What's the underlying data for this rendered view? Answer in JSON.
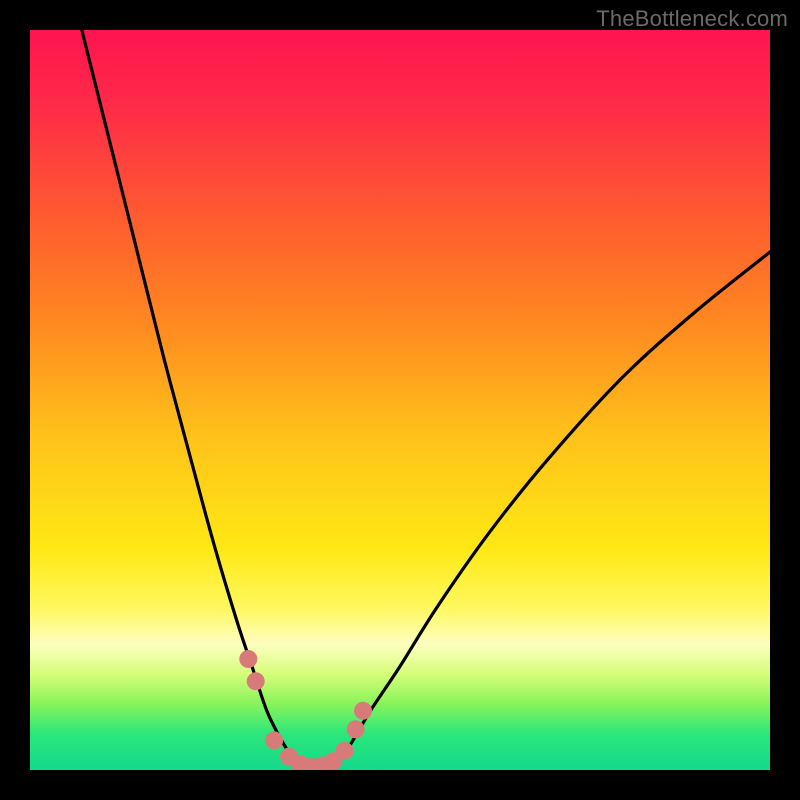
{
  "watermark": "TheBottleneck.com",
  "gradient_stops": [
    {
      "offset": 0.0,
      "color": "#ff1450"
    },
    {
      "offset": 0.1,
      "color": "#ff2a48"
    },
    {
      "offset": 0.25,
      "color": "#ff5a30"
    },
    {
      "offset": 0.4,
      "color": "#ff8a20"
    },
    {
      "offset": 0.55,
      "color": "#ffc21a"
    },
    {
      "offset": 0.7,
      "color": "#ffe814"
    },
    {
      "offset": 0.78,
      "color": "#fff85e"
    },
    {
      "offset": 0.83,
      "color": "#fdfec0"
    },
    {
      "offset": 0.87,
      "color": "#d6fd7a"
    },
    {
      "offset": 0.91,
      "color": "#8af45a"
    },
    {
      "offset": 0.95,
      "color": "#2de77a"
    },
    {
      "offset": 1.0,
      "color": "#13d98c"
    }
  ],
  "chart_data": {
    "type": "line",
    "title": "",
    "xlabel": "",
    "ylabel": "",
    "xlim": [
      0,
      100
    ],
    "ylim": [
      0,
      100
    ],
    "series": [
      {
        "name": "bottleneck-curve",
        "x": [
          7,
          10,
          14,
          18,
          22,
          25,
          28,
          30,
          32,
          34,
          36,
          38,
          40,
          41,
          43,
          46,
          50,
          55,
          62,
          70,
          80,
          90,
          100
        ],
        "y": [
          100,
          88,
          72,
          56,
          41,
          30,
          20,
          14,
          8,
          4,
          1,
          0,
          0,
          1,
          3,
          8,
          14,
          22,
          32,
          42,
          53,
          62,
          70
        ]
      }
    ],
    "markers": {
      "name": "highlight-dots",
      "color": "#d97a7a",
      "points": [
        {
          "x": 29.5,
          "y": 15
        },
        {
          "x": 30.5,
          "y": 12
        },
        {
          "x": 33.0,
          "y": 4
        },
        {
          "x": 35.0,
          "y": 1.8
        },
        {
          "x": 36.5,
          "y": 0.8
        },
        {
          "x": 38.0,
          "y": 0.4
        },
        {
          "x": 39.5,
          "y": 0.6
        },
        {
          "x": 41.0,
          "y": 1.2
        },
        {
          "x": 42.5,
          "y": 2.6
        },
        {
          "x": 44.0,
          "y": 5.5
        },
        {
          "x": 45.0,
          "y": 8.0
        }
      ]
    }
  }
}
